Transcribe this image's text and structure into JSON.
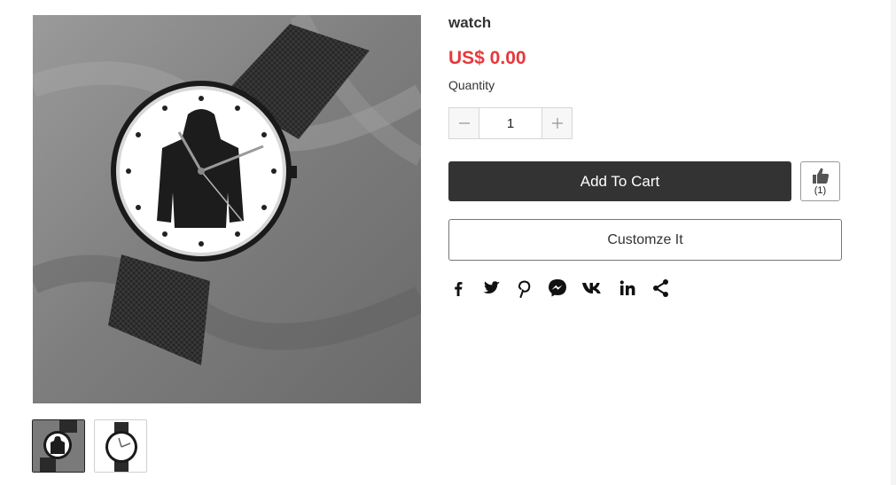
{
  "product": {
    "title": "watch",
    "price": "US$ 0.00",
    "quantity_label": "Quantity",
    "quantity_value": "1"
  },
  "gallery": {
    "thumbnails": [
      "watch-on-wrist",
      "watch-face-open"
    ],
    "active_thumbnail": 0
  },
  "actions": {
    "add_to_cart_label": "Add To Cart",
    "like_count": "(1)",
    "customize_label": "Customze It"
  },
  "share": {
    "icons": [
      "facebook-icon",
      "twitter-icon",
      "pinterest-icon",
      "messenger-icon",
      "vk-icon",
      "linkedin-icon",
      "share-icon"
    ]
  },
  "colors": {
    "price": "#e4393c",
    "primary_button": "#333333"
  }
}
